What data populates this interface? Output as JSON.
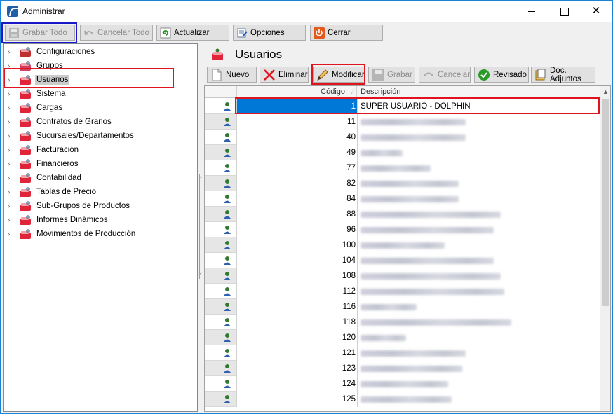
{
  "window": {
    "title": "Administrar"
  },
  "toolbar": {
    "grabar_todo": "Grabar Todo",
    "cancelar_todo": "Cancelar Todo",
    "actualizar": "Actualizar",
    "opciones": "Opciones",
    "cerrar": "Cerrar"
  },
  "tree": {
    "items": [
      {
        "label": "Configuraciones"
      },
      {
        "label": "Grupos"
      },
      {
        "label": "Usuarios",
        "selected": true
      },
      {
        "label": "Sistema"
      },
      {
        "label": "Cargas"
      },
      {
        "label": "Contratos de Granos"
      },
      {
        "label": "Sucursales/Departamentos"
      },
      {
        "label": "Facturación"
      },
      {
        "label": "Financieros"
      },
      {
        "label": "Contabilidad"
      },
      {
        "label": "Tablas de Precio"
      },
      {
        "label": "Sub-Grupos de Productos"
      },
      {
        "label": "Informes Dinámicos"
      },
      {
        "label": "Movimientos de Producción"
      }
    ]
  },
  "section": {
    "title": "Usuarios",
    "buttons": {
      "nuevo": "Nuevo",
      "eliminar": "Eliminar",
      "modificar": "Modificar",
      "grabar": "Grabar",
      "cancelar": "Cancelar",
      "revisado": "Revisado",
      "doc_adjuntos": "Doc. Adjuntos"
    }
  },
  "grid": {
    "columns": {
      "code": "Código",
      "description": "Descripción"
    },
    "rows": [
      {
        "code": "1",
        "description": "SUPER USUARIO - DOLPHIN",
        "selected": true
      },
      {
        "code": "11",
        "description": ""
      },
      {
        "code": "40",
        "description": ""
      },
      {
        "code": "49",
        "description": ""
      },
      {
        "code": "77",
        "description": ""
      },
      {
        "code": "82",
        "description": ""
      },
      {
        "code": "84",
        "description": ""
      },
      {
        "code": "88",
        "description": ""
      },
      {
        "code": "96",
        "description": ""
      },
      {
        "code": "100",
        "description": ""
      },
      {
        "code": "104",
        "description": ""
      },
      {
        "code": "108",
        "description": ""
      },
      {
        "code": "112",
        "description": ""
      },
      {
        "code": "116",
        "description": ""
      },
      {
        "code": "118",
        "description": ""
      },
      {
        "code": "120",
        "description": ""
      },
      {
        "code": "121",
        "description": ""
      },
      {
        "code": "123",
        "description": ""
      },
      {
        "code": "124",
        "description": ""
      },
      {
        "code": "125",
        "description": ""
      }
    ]
  },
  "colors": {
    "selection": "#0078d7",
    "highlight_red": "#e0141e",
    "highlight_blue": "#1919c8",
    "row_alt": "#e6e6e6"
  }
}
